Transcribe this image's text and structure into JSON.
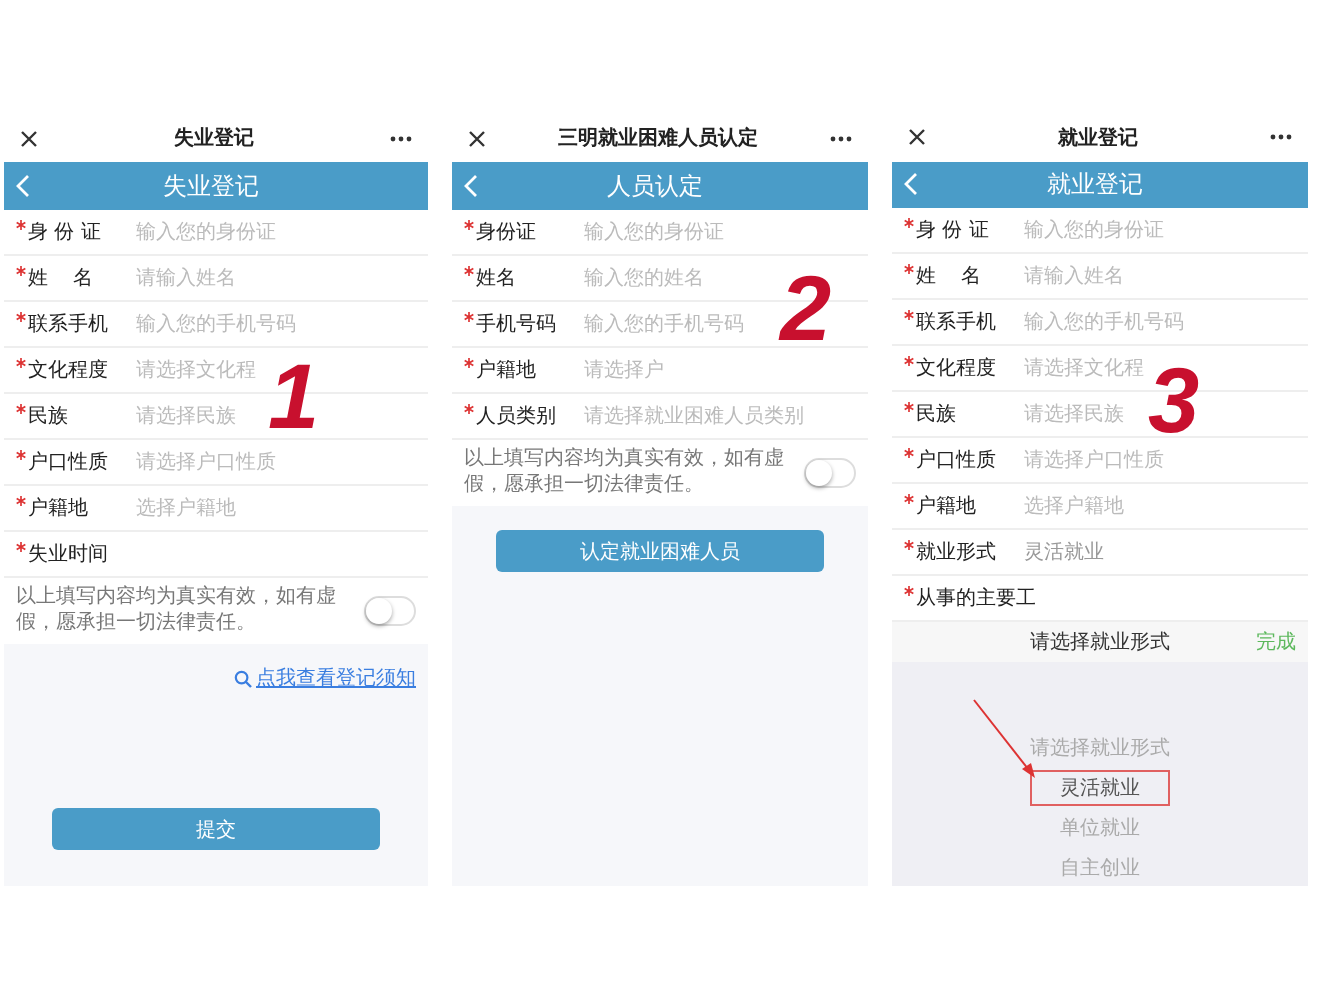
{
  "panels": [
    {
      "top_title": "失业登记",
      "header_title": "失业登记",
      "step_number": "1",
      "fields": [
        {
          "label": "身 份 证",
          "required": true,
          "placeholder": "输入您的身份证"
        },
        {
          "label": "姓    名",
          "required": true,
          "placeholder": "请输入姓名"
        },
        {
          "label": "联系手机",
          "required": true,
          "placeholder": "输入您的手机号码"
        },
        {
          "label": "文化程度",
          "required": true,
          "placeholder": "请选择文化程"
        },
        {
          "label": "民族",
          "required": true,
          "placeholder": "请选择民族"
        },
        {
          "label": "户口性质",
          "required": true,
          "placeholder": "请选择户口性质"
        },
        {
          "label": "户籍地",
          "required": true,
          "placeholder": "选择户籍地"
        },
        {
          "label": "失业时间",
          "required": true
        }
      ],
      "agreement": {
        "text": "以上填写内容均为真实有效，如有虚假，愿承担一切法律责任。",
        "on": false
      },
      "link": "点我查看登记须知",
      "submit_button": "提交"
    },
    {
      "top_title": "三明就业困难人员认定",
      "header_title": "人员认定",
      "step_number": "2",
      "fields": [
        {
          "label": "身份证",
          "required": true,
          "placeholder": "输入您的身份证"
        },
        {
          "label": "姓名",
          "required": true,
          "placeholder": "输入您的姓名"
        },
        {
          "label": "手机号码",
          "required": true,
          "placeholder": "输入您的手机号码"
        },
        {
          "label": "户籍地",
          "required": true,
          "placeholder": "请选择户"
        },
        {
          "label": "人员类别",
          "required": true,
          "placeholder": "请选择就业困难人员类别"
        }
      ],
      "agreement": {
        "text": "以上填写内容均为真实有效，如有虚假，愿承担一切法律责任。",
        "on": false
      },
      "submit_button": "认定就业困难人员"
    },
    {
      "top_title": "就业登记",
      "header_title": "就业登记",
      "step_number": "3",
      "fields": [
        {
          "label": "身 份 证",
          "required": true,
          "placeholder": "输入您的身份证"
        },
        {
          "label": "姓    名",
          "required": true,
          "placeholder": "请输入姓名"
        },
        {
          "label": "联系手机",
          "required": true,
          "placeholder": "输入您的手机号码"
        },
        {
          "label": "文化程度",
          "required": true,
          "placeholder": "请选择文化程"
        },
        {
          "label": "民族",
          "required": true,
          "placeholder": "请选择民族"
        },
        {
          "label": "户口性质",
          "required": true,
          "placeholder": "请选择户口性质"
        },
        {
          "label": "户籍地",
          "required": true,
          "placeholder": "选择户籍地"
        },
        {
          "label": "就业形式",
          "required": true,
          "value": "灵活就业"
        },
        {
          "label": "从事的主要工",
          "required": true
        }
      ],
      "picker": {
        "title": "请选择就业形式",
        "done": "完成",
        "options": [
          {
            "label": "请选择就业形式",
            "selected": false
          },
          {
            "label": "灵活就业",
            "selected": true
          },
          {
            "label": "单位就业",
            "selected": false
          },
          {
            "label": "自主创业",
            "selected": false
          }
        ]
      }
    }
  ]
}
